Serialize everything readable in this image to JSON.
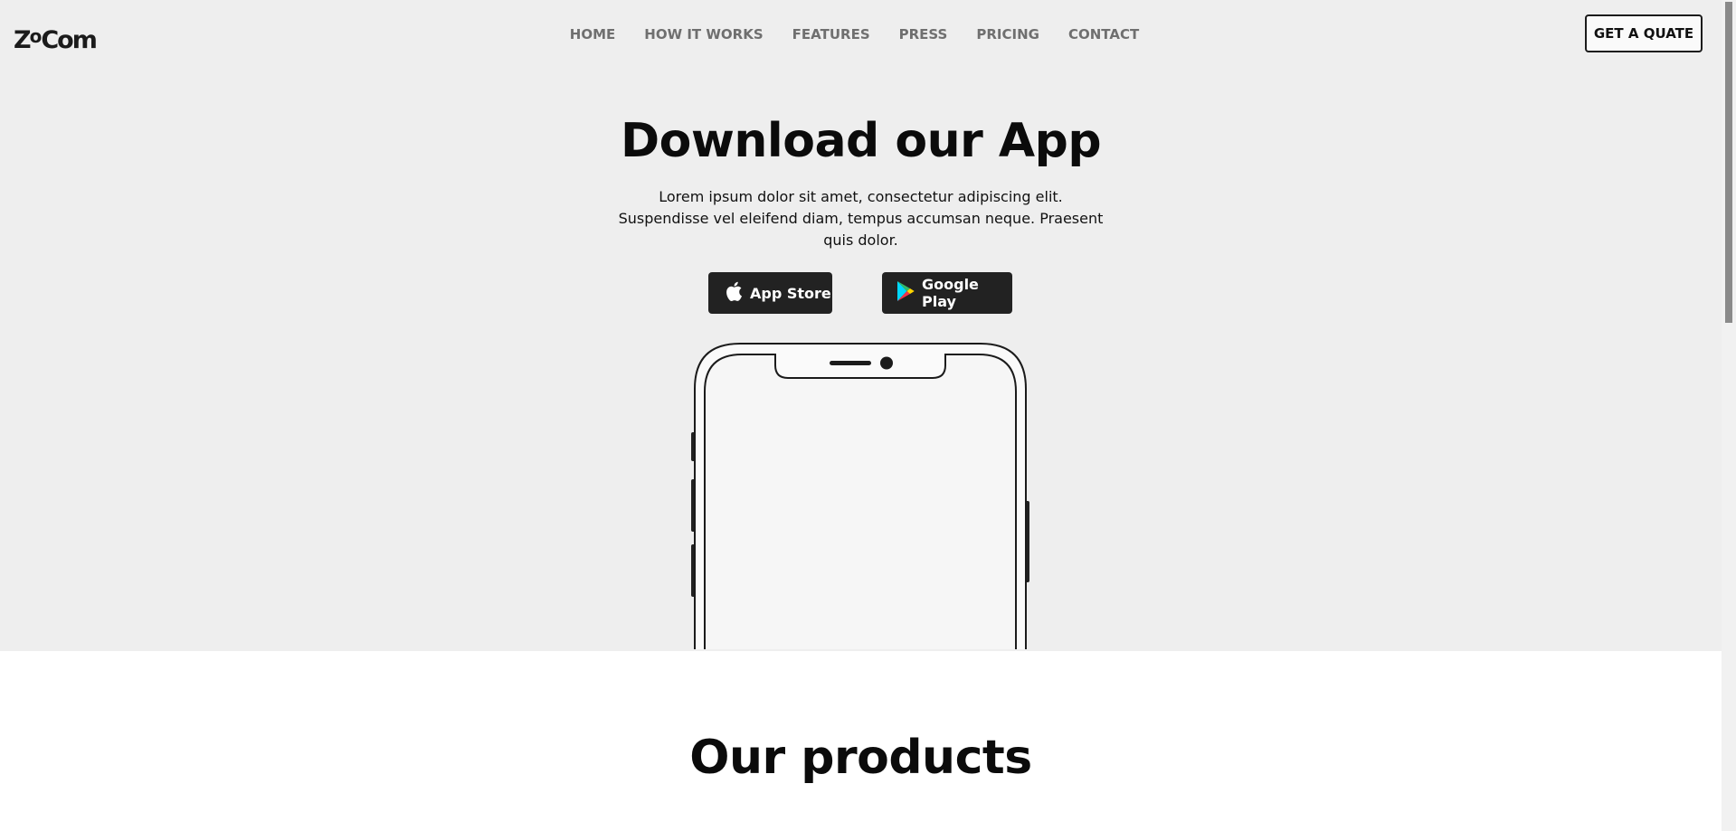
{
  "brand": {
    "logo_text_a": "Z",
    "logo_text_o": "o",
    "logo_text_b": "Com"
  },
  "nav": {
    "items": [
      {
        "label": "HOME"
      },
      {
        "label": "HOW IT WORKS"
      },
      {
        "label": "FEATURES"
      },
      {
        "label": "PRESS"
      },
      {
        "label": "PRICING"
      },
      {
        "label": "CONTACT"
      }
    ],
    "cta_label": "GET A QUATE"
  },
  "hero": {
    "title": "Download our App",
    "subtitle": "Lorem ipsum dolor sit amet, consectetur adipiscing elit. Suspendisse vel eleifend diam, tempus accumsan neque. Praesent quis dolor.",
    "buttons": {
      "app_store": {
        "label": "App Store",
        "icon": "apple-icon"
      },
      "google_play": {
        "label": "Google Play",
        "icon": "google-play-icon"
      }
    }
  },
  "products": {
    "title": "Our products"
  },
  "colors": {
    "hero_bg": "#eeeeee",
    "button_dark": "#222222",
    "nav_text": "#6f6f6f"
  }
}
